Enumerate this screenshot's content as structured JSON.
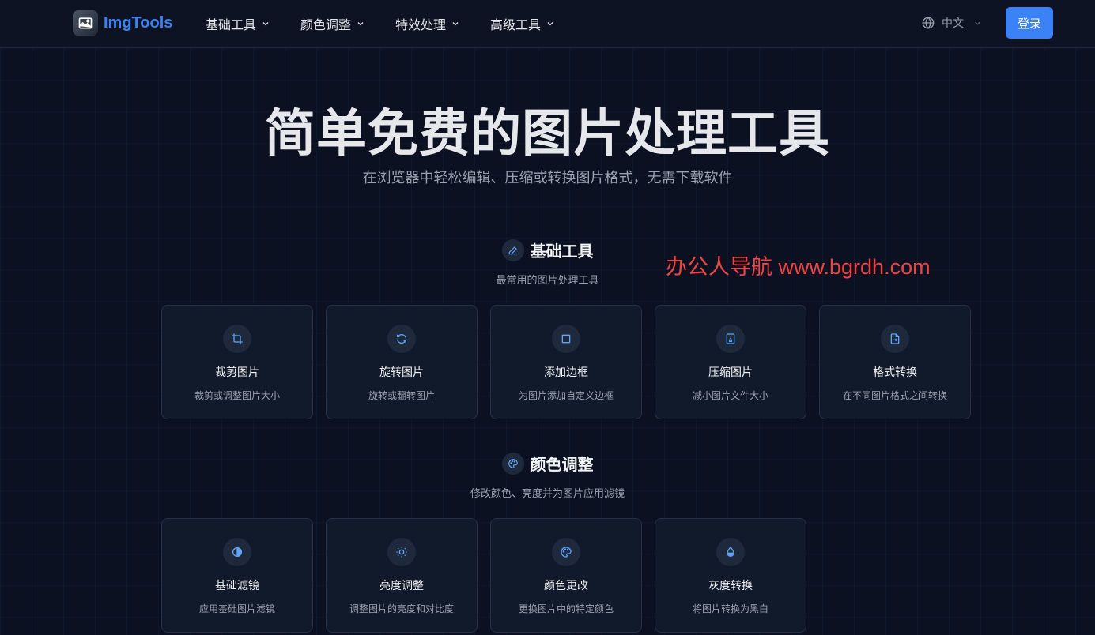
{
  "header": {
    "logo_text": "ImgTools",
    "nav": [
      {
        "label": "基础工具"
      },
      {
        "label": "颜色调整"
      },
      {
        "label": "特效处理"
      },
      {
        "label": "高级工具"
      }
    ],
    "language": "中文",
    "login_label": "登录"
  },
  "hero": {
    "title": "简单免费的图片处理工具",
    "subtitle": "在浏览器中轻松编辑、压缩或转换图片格式，无需下载软件"
  },
  "watermark": "办公人导航 www.bgrdh.com",
  "sections": [
    {
      "title": "基础工具",
      "desc": "最常用的图片处理工具",
      "icon": "pencil-icon",
      "cards": [
        {
          "title": "裁剪图片",
          "desc": "裁剪或调整图片大小",
          "icon": "crop-icon"
        },
        {
          "title": "旋转图片",
          "desc": "旋转或翻转图片",
          "icon": "rotate-icon"
        },
        {
          "title": "添加边框",
          "desc": "为图片添加自定义边框",
          "icon": "square-icon"
        },
        {
          "title": "压缩图片",
          "desc": "减小图片文件大小",
          "icon": "compress-icon"
        },
        {
          "title": "格式转换",
          "desc": "在不同图片格式之间转换",
          "icon": "file-convert-icon"
        }
      ]
    },
    {
      "title": "颜色调整",
      "desc": "修改颜色、亮度并为图片应用滤镜",
      "icon": "palette-icon",
      "cards": [
        {
          "title": "基础滤镜",
          "desc": "应用基础图片滤镜",
          "icon": "contrast-icon"
        },
        {
          "title": "亮度调整",
          "desc": "调整图片的亮度和对比度",
          "icon": "sun-icon"
        },
        {
          "title": "颜色更改",
          "desc": "更换图片中的特定颜色",
          "icon": "palette-icon"
        },
        {
          "title": "灰度转换",
          "desc": "将图片转换为黑白",
          "icon": "droplet-icon"
        }
      ]
    }
  ],
  "colors": {
    "accent": "#3b82f6",
    "background": "#0b1121",
    "card": "#111a2b",
    "watermark": "#ef4444"
  }
}
